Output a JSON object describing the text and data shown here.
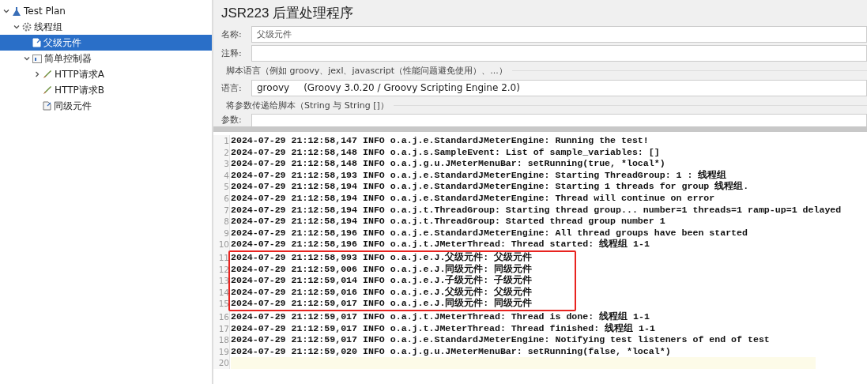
{
  "tree": [
    {
      "label": "Test Plan",
      "kind": "test-plan",
      "expanded": true,
      "selected": false,
      "children": [
        {
          "label": "线程组",
          "kind": "thread-group",
          "expanded": true,
          "selected": false,
          "children": [
            {
              "label": "父级元件",
              "kind": "script",
              "selected": true
            },
            {
              "label": "简单控制器",
              "kind": "controller",
              "expanded": true,
              "selected": false,
              "children": [
                {
                  "label": "HTTP请求A",
                  "kind": "sampler",
                  "expanded": false,
                  "selected": false
                },
                {
                  "label": "HTTP请求B",
                  "kind": "sampler",
                  "selected": false
                },
                {
                  "label": "同级元件",
                  "kind": "script",
                  "selected": false
                }
              ]
            }
          ]
        }
      ]
    }
  ],
  "panel": {
    "title": "JSR223 后置处理程序",
    "name": {
      "label": "名称:",
      "value": "父级元件"
    },
    "comment": {
      "label": "注释:"
    },
    "language_section": "脚本语言（例如 groovy、jexl、javascript（性能问题避免使用）、...）",
    "language": {
      "label": "语言:",
      "value": "groovy",
      "description": "(Groovy 3.0.20 / Groovy Scripting Engine 2.0)"
    },
    "params_section": "将参数传递给脚本（String 与 String []）",
    "params": {
      "label": "参数:"
    }
  },
  "log": {
    "lines": [
      {
        "number": "1",
        "text": "2024-07-29 21:12:58,147 INFO o.a.j.e.StandardJMeterEngine: Running the test!",
        "highlighted": false
      },
      {
        "number": "2",
        "text": "2024-07-29 21:12:58,148 INFO o.a.j.s.SampleEvent: List of sample_variables: []",
        "highlighted": false
      },
      {
        "number": "3",
        "text": "2024-07-29 21:12:58,148 INFO o.a.j.g.u.JMeterMenuBar: setRunning(true, *local*)",
        "highlighted": false
      },
      {
        "number": "4",
        "text": "2024-07-29 21:12:58,193 INFO o.a.j.e.StandardJMeterEngine: Starting ThreadGroup: 1 : 线程组",
        "highlighted": false
      },
      {
        "number": "5",
        "text": "2024-07-29 21:12:58,194 INFO o.a.j.e.StandardJMeterEngine: Starting 1 threads for group 线程组.",
        "highlighted": false
      },
      {
        "number": "6",
        "text": "2024-07-29 21:12:58,194 INFO o.a.j.e.StandardJMeterEngine: Thread will continue on error",
        "highlighted": false
      },
      {
        "number": "7",
        "text": "2024-07-29 21:12:58,194 INFO o.a.j.t.ThreadGroup: Starting thread group... number=1 threads=1 ramp-up=1 delayed",
        "highlighted": false
      },
      {
        "number": "8",
        "text": "2024-07-29 21:12:58,194 INFO o.a.j.t.ThreadGroup: Started thread group number 1",
        "highlighted": false
      },
      {
        "number": "9",
        "text": "2024-07-29 21:12:58,196 INFO o.a.j.e.StandardJMeterEngine: All thread groups have been started",
        "highlighted": false
      },
      {
        "number": "10",
        "text": "2024-07-29 21:12:58,196 INFO o.a.j.t.JMeterThread: Thread started: 线程组 1-1",
        "highlighted": false
      },
      {
        "number": "11",
        "text": "2024-07-29 21:12:58,993 INFO o.a.j.e.J.父级元件: 父级元件",
        "highlighted": true
      },
      {
        "number": "12",
        "text": "2024-07-29 21:12:59,006 INFO o.a.j.e.J.同级元件: 同级元件",
        "highlighted": true
      },
      {
        "number": "13",
        "text": "2024-07-29 21:12:59,014 INFO o.a.j.e.J.子级元件: 子级元件",
        "highlighted": true
      },
      {
        "number": "14",
        "text": "2024-07-29 21:12:59,016 INFO o.a.j.e.J.父级元件: 父级元件",
        "highlighted": true
      },
      {
        "number": "15",
        "text": "2024-07-29 21:12:59,017 INFO o.a.j.e.J.同级元件: 同级元件",
        "highlighted": true
      },
      {
        "number": "16",
        "text": "2024-07-29 21:12:59,017 INFO o.a.j.t.JMeterThread: Thread is done: 线程组 1-1",
        "highlighted": false
      },
      {
        "number": "17",
        "text": "2024-07-29 21:12:59,017 INFO o.a.j.t.JMeterThread: Thread finished: 线程组 1-1",
        "highlighted": false
      },
      {
        "number": "18",
        "text": "2024-07-29 21:12:59,017 INFO o.a.j.e.StandardJMeterEngine: Notifying test listeners of end of test",
        "highlighted": false
      },
      {
        "number": "19",
        "text": "2024-07-29 21:12:59,020 INFO o.a.j.g.u.JMeterMenuBar: setRunning(false, *local*)",
        "highlighted": false
      },
      {
        "number": "20",
        "current": true,
        "highlighted": false
      }
    ]
  }
}
